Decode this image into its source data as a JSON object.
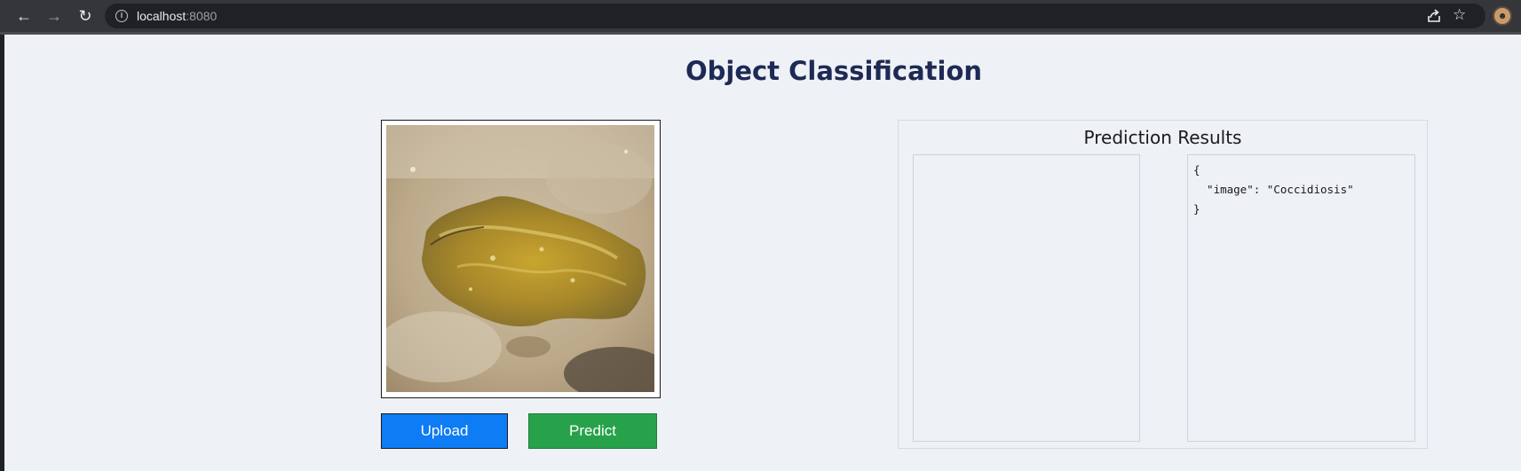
{
  "browser": {
    "url_host": "localhost",
    "url_port": ":8080",
    "icons": [
      "back-arrow-icon",
      "forward-arrow-icon",
      "reload-icon",
      "info-icon",
      "share-icon",
      "star-icon",
      "profile-avatar"
    ]
  },
  "page": {
    "title": "Object Classification",
    "image_alt": "uploaded poultry droppings image",
    "upload_label": "Upload",
    "predict_label": "Predict",
    "colors": {
      "upload": "#0d7cf5",
      "predict": "#27a24b",
      "title": "#1e2a55",
      "background": "#eef1f5"
    }
  },
  "results": {
    "title": "Prediction Results",
    "json_text": "{\n  \"image\": \"Coccidiosis\"\n}"
  }
}
